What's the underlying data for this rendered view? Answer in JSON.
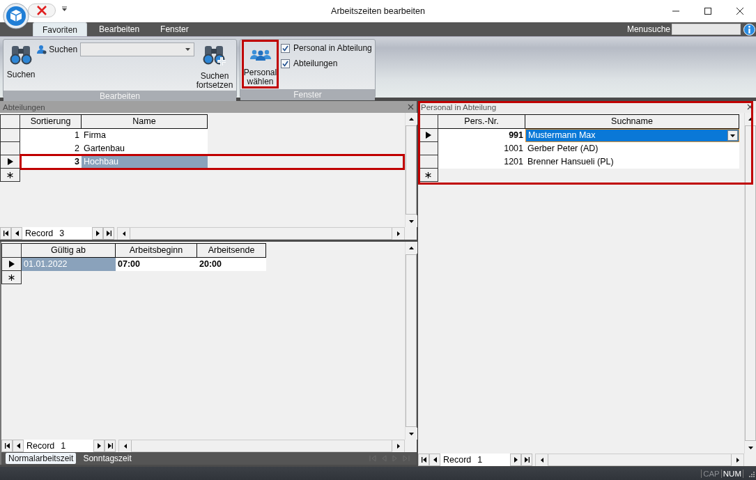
{
  "window": {
    "title": "Arbeitszeiten bearbeiten"
  },
  "ribbon": {
    "tabs": [
      {
        "label": "Favoriten",
        "selected": true
      },
      {
        "label": "Bearbeiten",
        "selected": false
      },
      {
        "label": "Fenster",
        "selected": false
      }
    ],
    "menu_search": {
      "label": "Menusuche"
    },
    "edit_group": {
      "label": "Bearbeiten",
      "search_button": "Suchen",
      "search_field_label": "Suchen",
      "continue_button": "Suchen fortsetzen"
    },
    "window_group": {
      "label": "Fenster",
      "select_button": {
        "label": "Personal wählen",
        "highlighted": true
      },
      "checkboxes": [
        {
          "label": "Personal in Abteilung",
          "checked": true
        },
        {
          "label": "Abteilungen",
          "checked": true
        }
      ]
    }
  },
  "departments": {
    "title": "Abteilungen",
    "active": false,
    "columns": [
      {
        "label": "Sortierung",
        "kind": "number",
        "focused": false
      },
      {
        "label": "Name",
        "kind": "text",
        "focused": true
      }
    ],
    "rows": [
      {
        "cells": [
          "1",
          "Firma"
        ],
        "selected": false,
        "highlighted": false
      },
      {
        "cells": [
          "2",
          "Gartenbau"
        ],
        "selected": false,
        "highlighted": false
      },
      {
        "cells": [
          "3",
          "Hochbau"
        ],
        "selected": true,
        "highlighted": true
      }
    ],
    "record": {
      "label": "Record",
      "value": "3"
    }
  },
  "work_times": {
    "columns": [
      {
        "label": "Gültig ab",
        "kind": "text",
        "focused": true
      },
      {
        "label": "Arbeitsbeginn",
        "kind": "text",
        "focused": false
      },
      {
        "label": "Arbeitsende",
        "kind": "text",
        "focused": false
      }
    ],
    "rows": [
      {
        "cells": [
          "01.01.2022",
          "07:00",
          "20:00"
        ],
        "selected": true,
        "highlighted": false
      }
    ],
    "record": {
      "label": "Record",
      "value": "1"
    },
    "tabs": [
      {
        "label": "Normalarbeitszeit",
        "selected": true
      },
      {
        "label": "Sonntagszeit",
        "selected": false
      }
    ]
  },
  "staff": {
    "title": "Personal in Abteilung",
    "active": true,
    "highlighted": true,
    "columns": [
      {
        "label": "Pers.-Nr.",
        "kind": "number",
        "focused": false
      },
      {
        "label": "Suchname",
        "kind": "lookup",
        "focused": true
      }
    ],
    "rows": [
      {
        "cells": [
          "991",
          "Mustermann Max"
        ],
        "selected": true,
        "highlighted": false
      },
      {
        "cells": [
          "1001",
          "Gerber Peter (AD)"
        ],
        "selected": false,
        "highlighted": false
      },
      {
        "cells": [
          "1201",
          "Brenner Hansueli (PL)"
        ],
        "selected": false,
        "highlighted": false
      }
    ],
    "record": {
      "label": "Record",
      "value": "1"
    }
  },
  "status_bar": {
    "indicators": [
      {
        "label": "CAP",
        "on": false
      },
      {
        "label": "NUM",
        "on": true
      }
    ]
  }
}
